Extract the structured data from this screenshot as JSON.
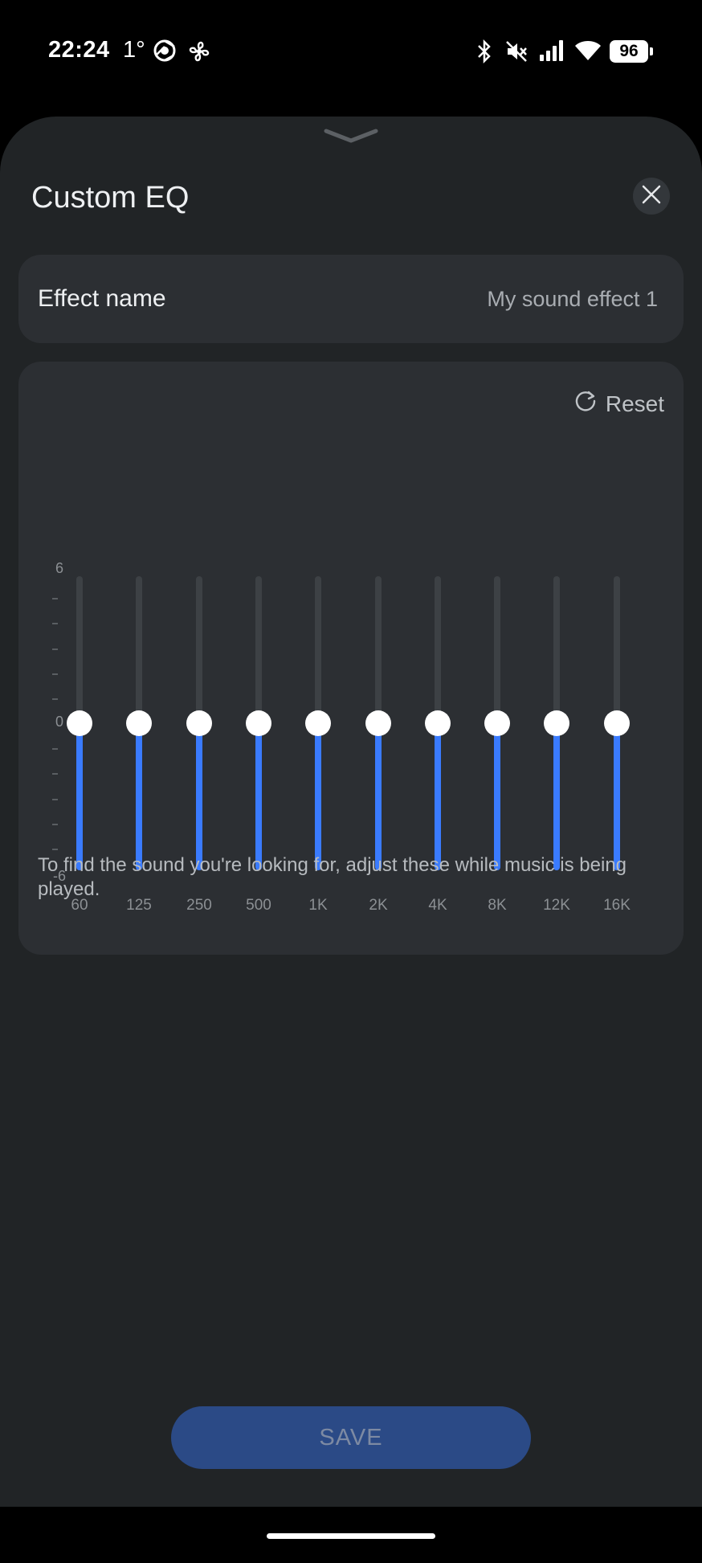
{
  "status_bar": {
    "time": "22:24",
    "temperature": "1°",
    "battery": "96",
    "icons": [
      "chrome-icon",
      "fan-icon",
      "bluetooth-icon",
      "mute-icon",
      "signal-icon",
      "wifi-icon",
      "battery-icon"
    ]
  },
  "sheet": {
    "title": "Custom EQ",
    "close_icon": "close-icon"
  },
  "effect": {
    "label": "Effect name",
    "value": "My sound effect 1"
  },
  "eq": {
    "reset_label": "Reset",
    "scale": {
      "max": "6",
      "zero": "0",
      "min": "-6"
    },
    "range": [
      -6,
      6
    ],
    "bands": [
      {
        "label": "60",
        "value": 0
      },
      {
        "label": "125",
        "value": 0
      },
      {
        "label": "250",
        "value": 0
      },
      {
        "label": "500",
        "value": 0
      },
      {
        "label": "1K",
        "value": 0
      },
      {
        "label": "2K",
        "value": 0
      },
      {
        "label": "4K",
        "value": 0
      },
      {
        "label": "8K",
        "value": 0
      },
      {
        "label": "12K",
        "value": 0
      },
      {
        "label": "16K",
        "value": 0
      }
    ]
  },
  "hint": "To find the sound you're looking for, adjust these while music is being played.",
  "save_label": "SAVE",
  "colors": {
    "accent": "#3a7bff",
    "sheet_bg": "#212426",
    "card_bg": "#2c2f33",
    "save_bg": "#2b4a86"
  }
}
